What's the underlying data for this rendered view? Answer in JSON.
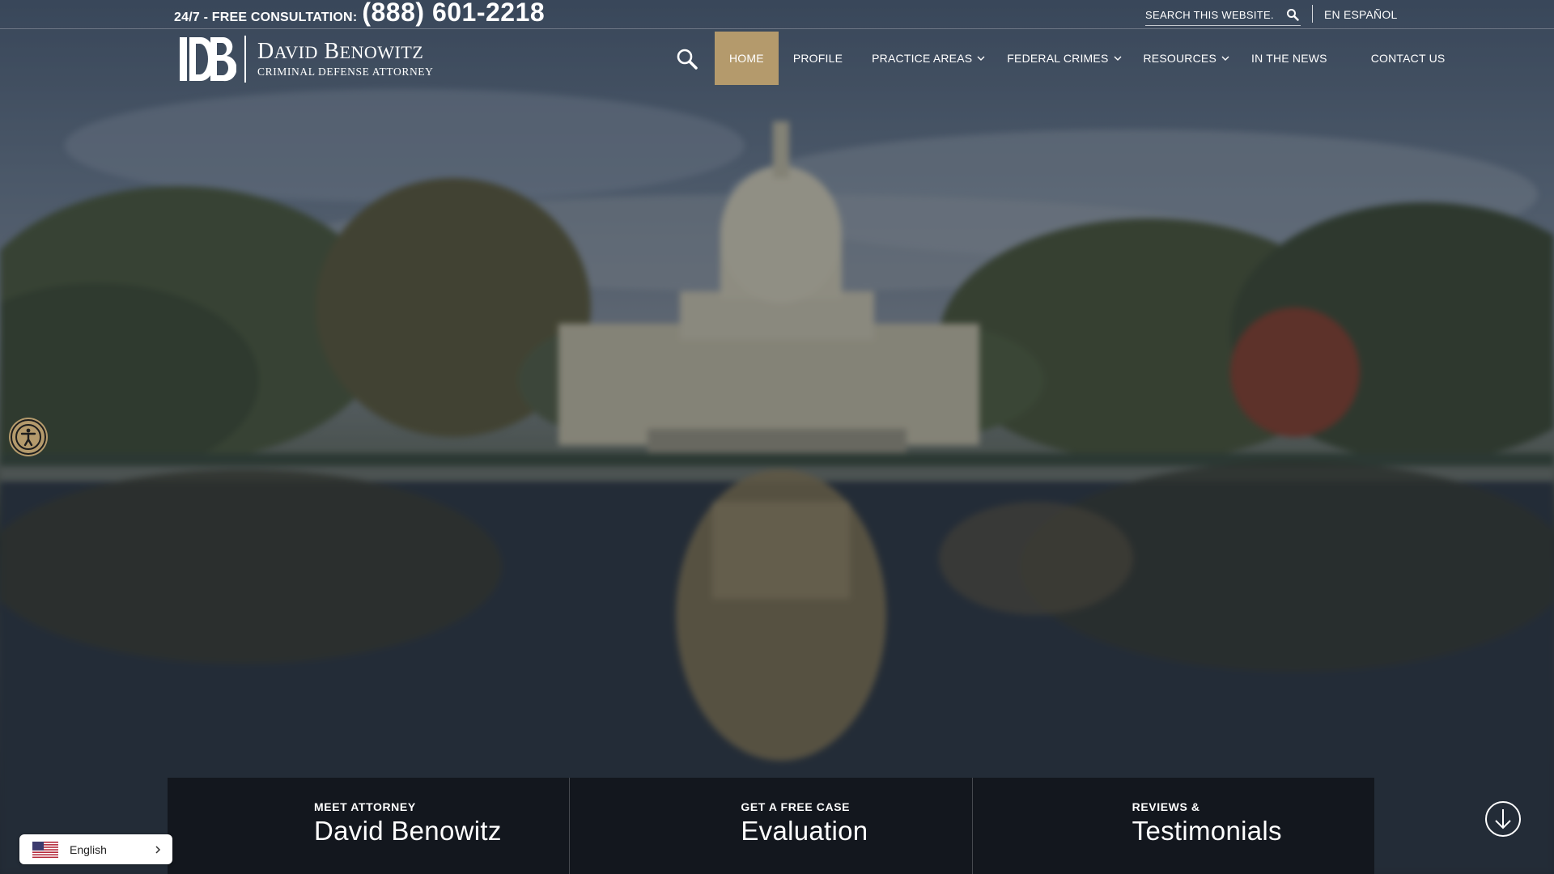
{
  "topbar": {
    "consult_label": "24/7 - FREE CONSULTATION:",
    "phone": "(888) 601-2218",
    "search_placeholder": "SEARCH THIS WEBSITE...",
    "spanish_link": "EN ESPAÑOL"
  },
  "logo": {
    "name_first_initial": "D",
    "name_first_rest": "AVID",
    "name_last_initial": "B",
    "name_last_rest": "ENOWITZ",
    "subtitle": "CRIMINAL DEFENSE ATTORNEY"
  },
  "nav": {
    "items": [
      {
        "label": "HOME",
        "active": true,
        "has_submenu": false
      },
      {
        "label": "PROFILE",
        "active": false,
        "has_submenu": false
      },
      {
        "label": "PRACTICE AREAS",
        "active": false,
        "has_submenu": true
      },
      {
        "label": "FEDERAL CRIMES",
        "active": false,
        "has_submenu": true
      },
      {
        "label": "RESOURCES",
        "active": false,
        "has_submenu": true
      },
      {
        "label": "IN THE NEWS",
        "active": false,
        "has_submenu": false
      },
      {
        "label": "CONTACT US",
        "active": false,
        "has_submenu": false
      }
    ]
  },
  "features": [
    {
      "kicker": "MEET ATTORNEY",
      "title": "David Benowitz"
    },
    {
      "kicker": "GET A FREE CASE",
      "title": "Evaluation"
    },
    {
      "kicker": "REVIEWS &",
      "title": "Testimonials"
    }
  ],
  "language_widget": {
    "label": "English",
    "flag": "us-flag-icon"
  },
  "icons": {
    "search": "search-icon",
    "chevron": "chevron-down-icon",
    "accessibility": "accessibility-icon",
    "scroll": "arrow-down-circle-icon"
  },
  "colors": {
    "accent": "#b49a6c",
    "feature_bg": "#11141b",
    "text": "#ffffff"
  }
}
